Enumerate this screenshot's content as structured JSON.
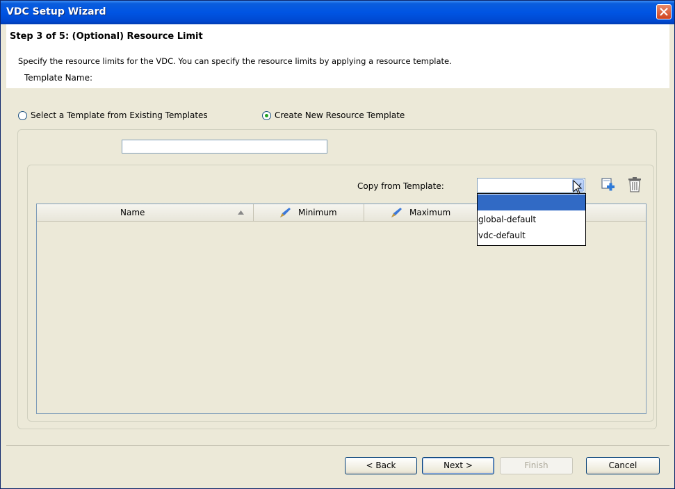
{
  "window": {
    "title": "VDC Setup Wizard"
  },
  "header": {
    "step_title": "Step 3 of 5: (Optional) Resource Limit",
    "description": "Specify the resource limits for the VDC. You can specify the resource limits by applying a resource template."
  },
  "options": {
    "existing_label": "Select a Template from Existing Templates",
    "create_label": "Create New Resource Template",
    "selected": "create"
  },
  "template_name": {
    "label": "Template Name:",
    "value": ""
  },
  "copy_from": {
    "label": "Copy from Template:",
    "value": "",
    "options": [
      "",
      "global-default",
      "vdc-default"
    ]
  },
  "table": {
    "columns": [
      "Name",
      "Minimum",
      "Maximum"
    ],
    "rows": []
  },
  "buttons": {
    "back": "< Back",
    "next": "Next >",
    "finish": "Finish",
    "cancel": "Cancel"
  },
  "icons": {
    "close": "close-icon",
    "add": "add-template-icon",
    "delete": "trash-icon",
    "edit": "pen-icon",
    "sort": "sort-ascending-icon",
    "dropdown": "chevron-down-icon"
  },
  "colors": {
    "titlebar": "#0054e3",
    "selection": "#316ac5",
    "background": "#ece9d8"
  }
}
